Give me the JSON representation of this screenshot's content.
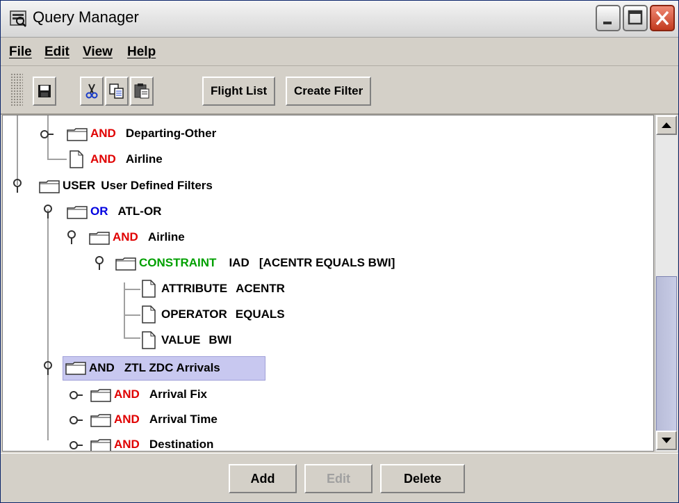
{
  "window": {
    "title": "Query Manager"
  },
  "menu": [
    "File",
    "Edit",
    "View",
    "Help"
  ],
  "toolbar": {
    "icons": [
      "save-icon",
      "cut-icon",
      "copy-icon",
      "paste-icon"
    ],
    "flight_list": "Flight List",
    "create_filter": "Create Filter"
  },
  "tree": {
    "rows": [
      {
        "type": "AND",
        "name": "Departing-Other",
        "node": "folder",
        "expanded": false
      },
      {
        "type": "AND",
        "name": "Airline",
        "node": "leaf"
      },
      {
        "type": "USER",
        "name": "User Defined Filters",
        "node": "folder",
        "expanded": true
      },
      {
        "type": "OR",
        "name": "ATL-OR",
        "node": "folder",
        "expanded": true
      },
      {
        "type": "AND",
        "name": "Airline",
        "node": "folder",
        "expanded": true
      },
      {
        "type": "CONSTRAINT",
        "name": "IAD   [ACENTR EQUALS BWI]",
        "node": "folder",
        "expanded": true
      },
      {
        "type": "ATTRIBUTE",
        "name": "ACENTR",
        "node": "leaf"
      },
      {
        "type": "OPERATOR",
        "name": "EQUALS",
        "node": "leaf"
      },
      {
        "type": "VALUE",
        "name": "BWI",
        "node": "leaf"
      },
      {
        "type": "AND",
        "name": "ZTL ZDC Arrivals",
        "node": "folder",
        "expanded": true,
        "selected": true
      },
      {
        "type": "AND",
        "name": "Arrival Fix",
        "node": "folder",
        "expanded": false
      },
      {
        "type": "AND",
        "name": "Arrival Time",
        "node": "folder",
        "expanded": false
      },
      {
        "type": "AND",
        "name": "Destination",
        "node": "folder",
        "expanded": false
      }
    ]
  },
  "buttons": {
    "add": "Add",
    "edit": "Edit",
    "delete": "Delete"
  },
  "colors": {
    "and": "#e00000",
    "or": "#0000e0",
    "constraint": "#00a000",
    "selection": "#c8c8f0"
  }
}
